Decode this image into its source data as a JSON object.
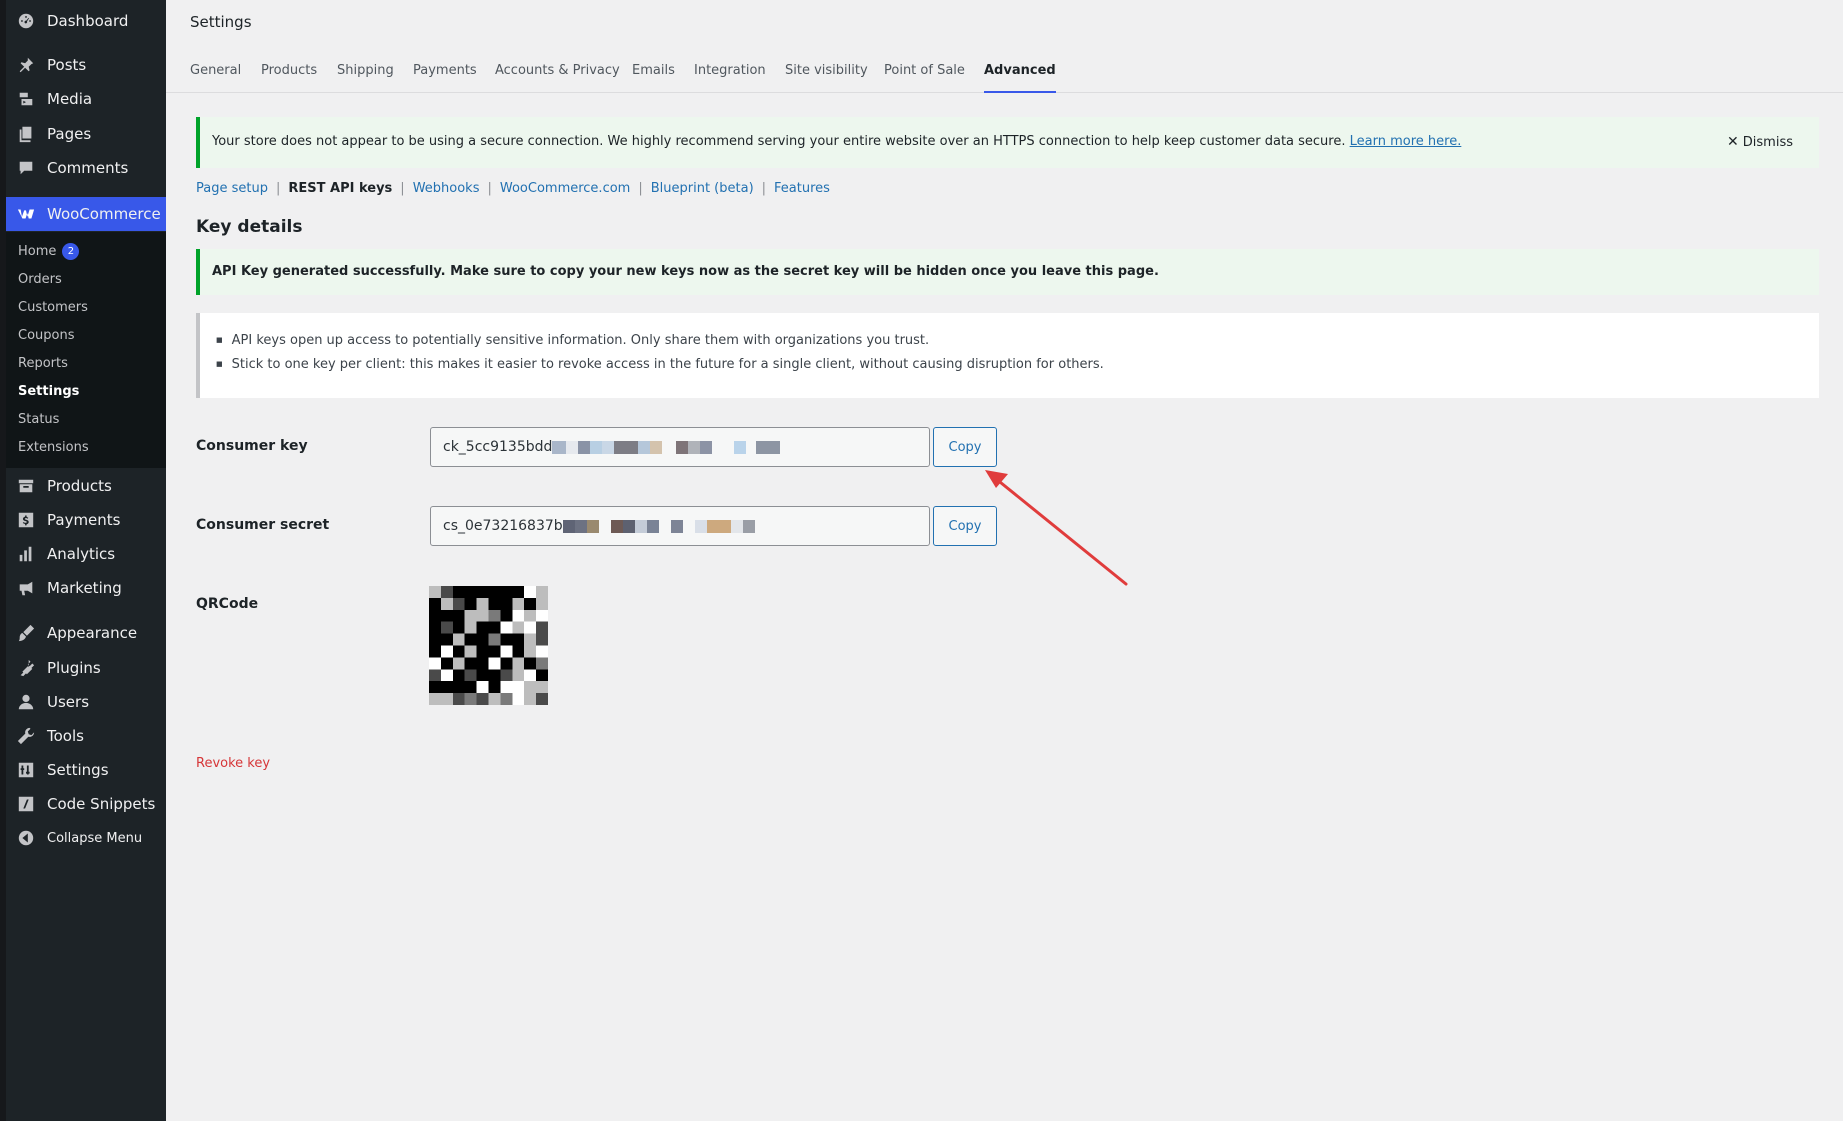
{
  "sidebar": {
    "items": [
      {
        "label": "Dashboard",
        "icon": "dashboard-icon"
      },
      {
        "label": "Posts",
        "icon": "pin-icon"
      },
      {
        "label": "Media",
        "icon": "media-icon"
      },
      {
        "label": "Pages",
        "icon": "pages-icon"
      },
      {
        "label": "Comments",
        "icon": "comment-icon"
      },
      {
        "label": "WooCommerce",
        "icon": "woocommerce-icon"
      },
      {
        "label": "Products",
        "icon": "archive-icon"
      },
      {
        "label": "Payments",
        "icon": "dollar-icon"
      },
      {
        "label": "Analytics",
        "icon": "bar-chart-icon"
      },
      {
        "label": "Marketing",
        "icon": "megaphone-icon"
      },
      {
        "label": "Appearance",
        "icon": "brush-icon"
      },
      {
        "label": "Plugins",
        "icon": "plug-icon"
      },
      {
        "label": "Users",
        "icon": "user-icon"
      },
      {
        "label": "Tools",
        "icon": "wrench-icon"
      },
      {
        "label": "Settings",
        "icon": "sliders-icon"
      },
      {
        "label": "Code Snippets",
        "icon": "code-icon"
      },
      {
        "label": "Collapse Menu",
        "icon": "collapse-icon"
      }
    ],
    "woo_submenu": [
      {
        "label": "Home",
        "badge": "2"
      },
      {
        "label": "Orders"
      },
      {
        "label": "Customers"
      },
      {
        "label": "Coupons"
      },
      {
        "label": "Reports"
      },
      {
        "label": "Settings"
      },
      {
        "label": "Status"
      },
      {
        "label": "Extensions"
      }
    ]
  },
  "header": {
    "title": "Settings",
    "tabs": [
      "General",
      "Products",
      "Shipping",
      "Payments",
      "Accounts & Privacy",
      "Emails",
      "Integration",
      "Site visibility",
      "Point of Sale",
      "Advanced"
    ],
    "active_tab": "Advanced"
  },
  "https_notice": {
    "text": "Your store does not appear to be using a secure connection. We highly recommend serving your entire website over an HTTPS connection to help keep customer data secure.",
    "link": "Learn more here.",
    "dismiss": "Dismiss"
  },
  "subnav": {
    "items": [
      "Page setup",
      "REST API keys",
      "Webhooks",
      "WooCommerce.com",
      "Blueprint (beta)",
      "Features"
    ],
    "current": "REST API keys"
  },
  "key_details": {
    "title": "Key details",
    "success": "API Key generated successfully. Make sure to copy your new keys now as the secret key will be hidden once you leave this page.",
    "info": [
      "API keys open up access to potentially sensitive information. Only share them with organizations you trust.",
      "Stick to one key per client: this makes it easier to revoke access in the future for a single client, without causing disruption for others."
    ],
    "consumer_key_label": "Consumer key",
    "consumer_key_value": "ck_5cc9135bdd",
    "consumer_secret_label": "Consumer secret",
    "consumer_secret_value": "cs_0e73216837b",
    "copy_label": "Copy",
    "qrcode_label": "QRCode",
    "revoke_label": "Revoke key"
  },
  "colors": {
    "sidebar_bg": "#1d2327",
    "accent": "#3858e9",
    "link": "#2271b1",
    "success_border": "#00a32a",
    "danger": "#d63638",
    "annotation_arrow": "#e03c3c"
  }
}
